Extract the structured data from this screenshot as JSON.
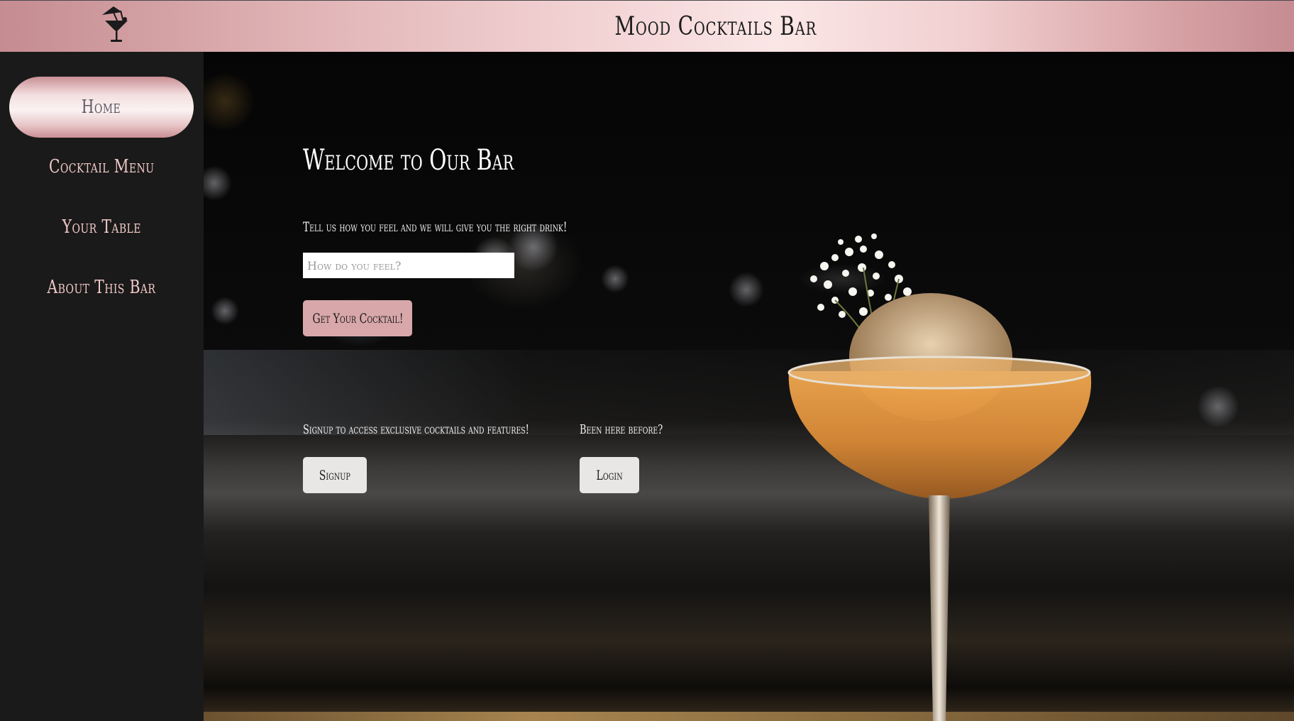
{
  "header": {
    "title": "Mood Cocktails Bar",
    "logo_icon": "cocktail-umbrella-icon"
  },
  "sidebar": {
    "items": [
      {
        "label": "Home",
        "active": true
      },
      {
        "label": "Cocktail Menu",
        "active": false
      },
      {
        "label": "Your Table",
        "active": false
      },
      {
        "label": "About This Bar",
        "active": false
      }
    ]
  },
  "main": {
    "welcome": "Welcome to Our Bar",
    "prompt": "Tell us how you feel and we will give you the right drink!",
    "mood_input": {
      "value": "",
      "placeholder": "How do you feel?"
    },
    "get_cocktail_label": "Get Your Cocktail!",
    "signup_text": "Signup to access exclusive cocktails and features!",
    "signup_label": "Signup",
    "login_text": "Been here before?",
    "login_label": "Login"
  },
  "colors": {
    "accent_pink": "#d8a7aa",
    "sidebar_bg": "#1a1a1a",
    "nav_text": "#f1c9c7"
  }
}
